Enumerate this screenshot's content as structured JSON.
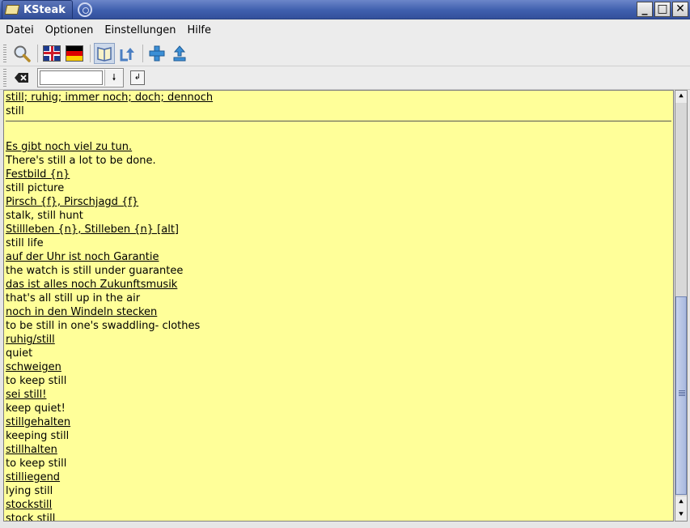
{
  "window": {
    "title": "KSteak"
  },
  "menu": {
    "items": [
      "Datei",
      "Optionen",
      "Einstellungen",
      "Hilfe"
    ]
  },
  "search": {
    "value": "",
    "placeholder": ""
  },
  "results": {
    "header_de": "still; ruhig; immer noch; doch; dennoch ",
    "header_en": "still",
    "entries": [
      {
        "de": "Es gibt noch viel zu tun. ",
        "en": "There's still a lot to be done."
      },
      {
        "de": "Festbild {n} ",
        "en": "still picture"
      },
      {
        "de": "Pirsch {f}, Pirschjagd {f} ",
        "en": "stalk, still hunt"
      },
      {
        "de": "Stillleben {n}, Stilleben {n} [alt] ",
        "en": "still life"
      },
      {
        "de": "auf der Uhr ist noch Garantie ",
        "en": "the watch is still under guarantee"
      },
      {
        "de": "das ist alles noch Zukunftsmusik ",
        "en": "that's all still up in the air"
      },
      {
        "de": "noch in den Windeln stecken ",
        "en": "to be still in one's swaddling- clothes"
      },
      {
        "de": "ruhig/still ",
        "en": "quiet"
      },
      {
        "de": "schweigen ",
        "en": "to keep still"
      },
      {
        "de": "sei still! ",
        "en": "keep quiet!"
      },
      {
        "de": "stillgehalten ",
        "en": "keeping still"
      },
      {
        "de": "stillhalten ",
        "en": "to keep still"
      },
      {
        "de": "stilliegend ",
        "en": "lying still"
      },
      {
        "de": "stockstill ",
        "en": "stock still"
      }
    ]
  },
  "colors": {
    "content_bg": "#ffff99",
    "titlebar": "#3f5fae"
  }
}
